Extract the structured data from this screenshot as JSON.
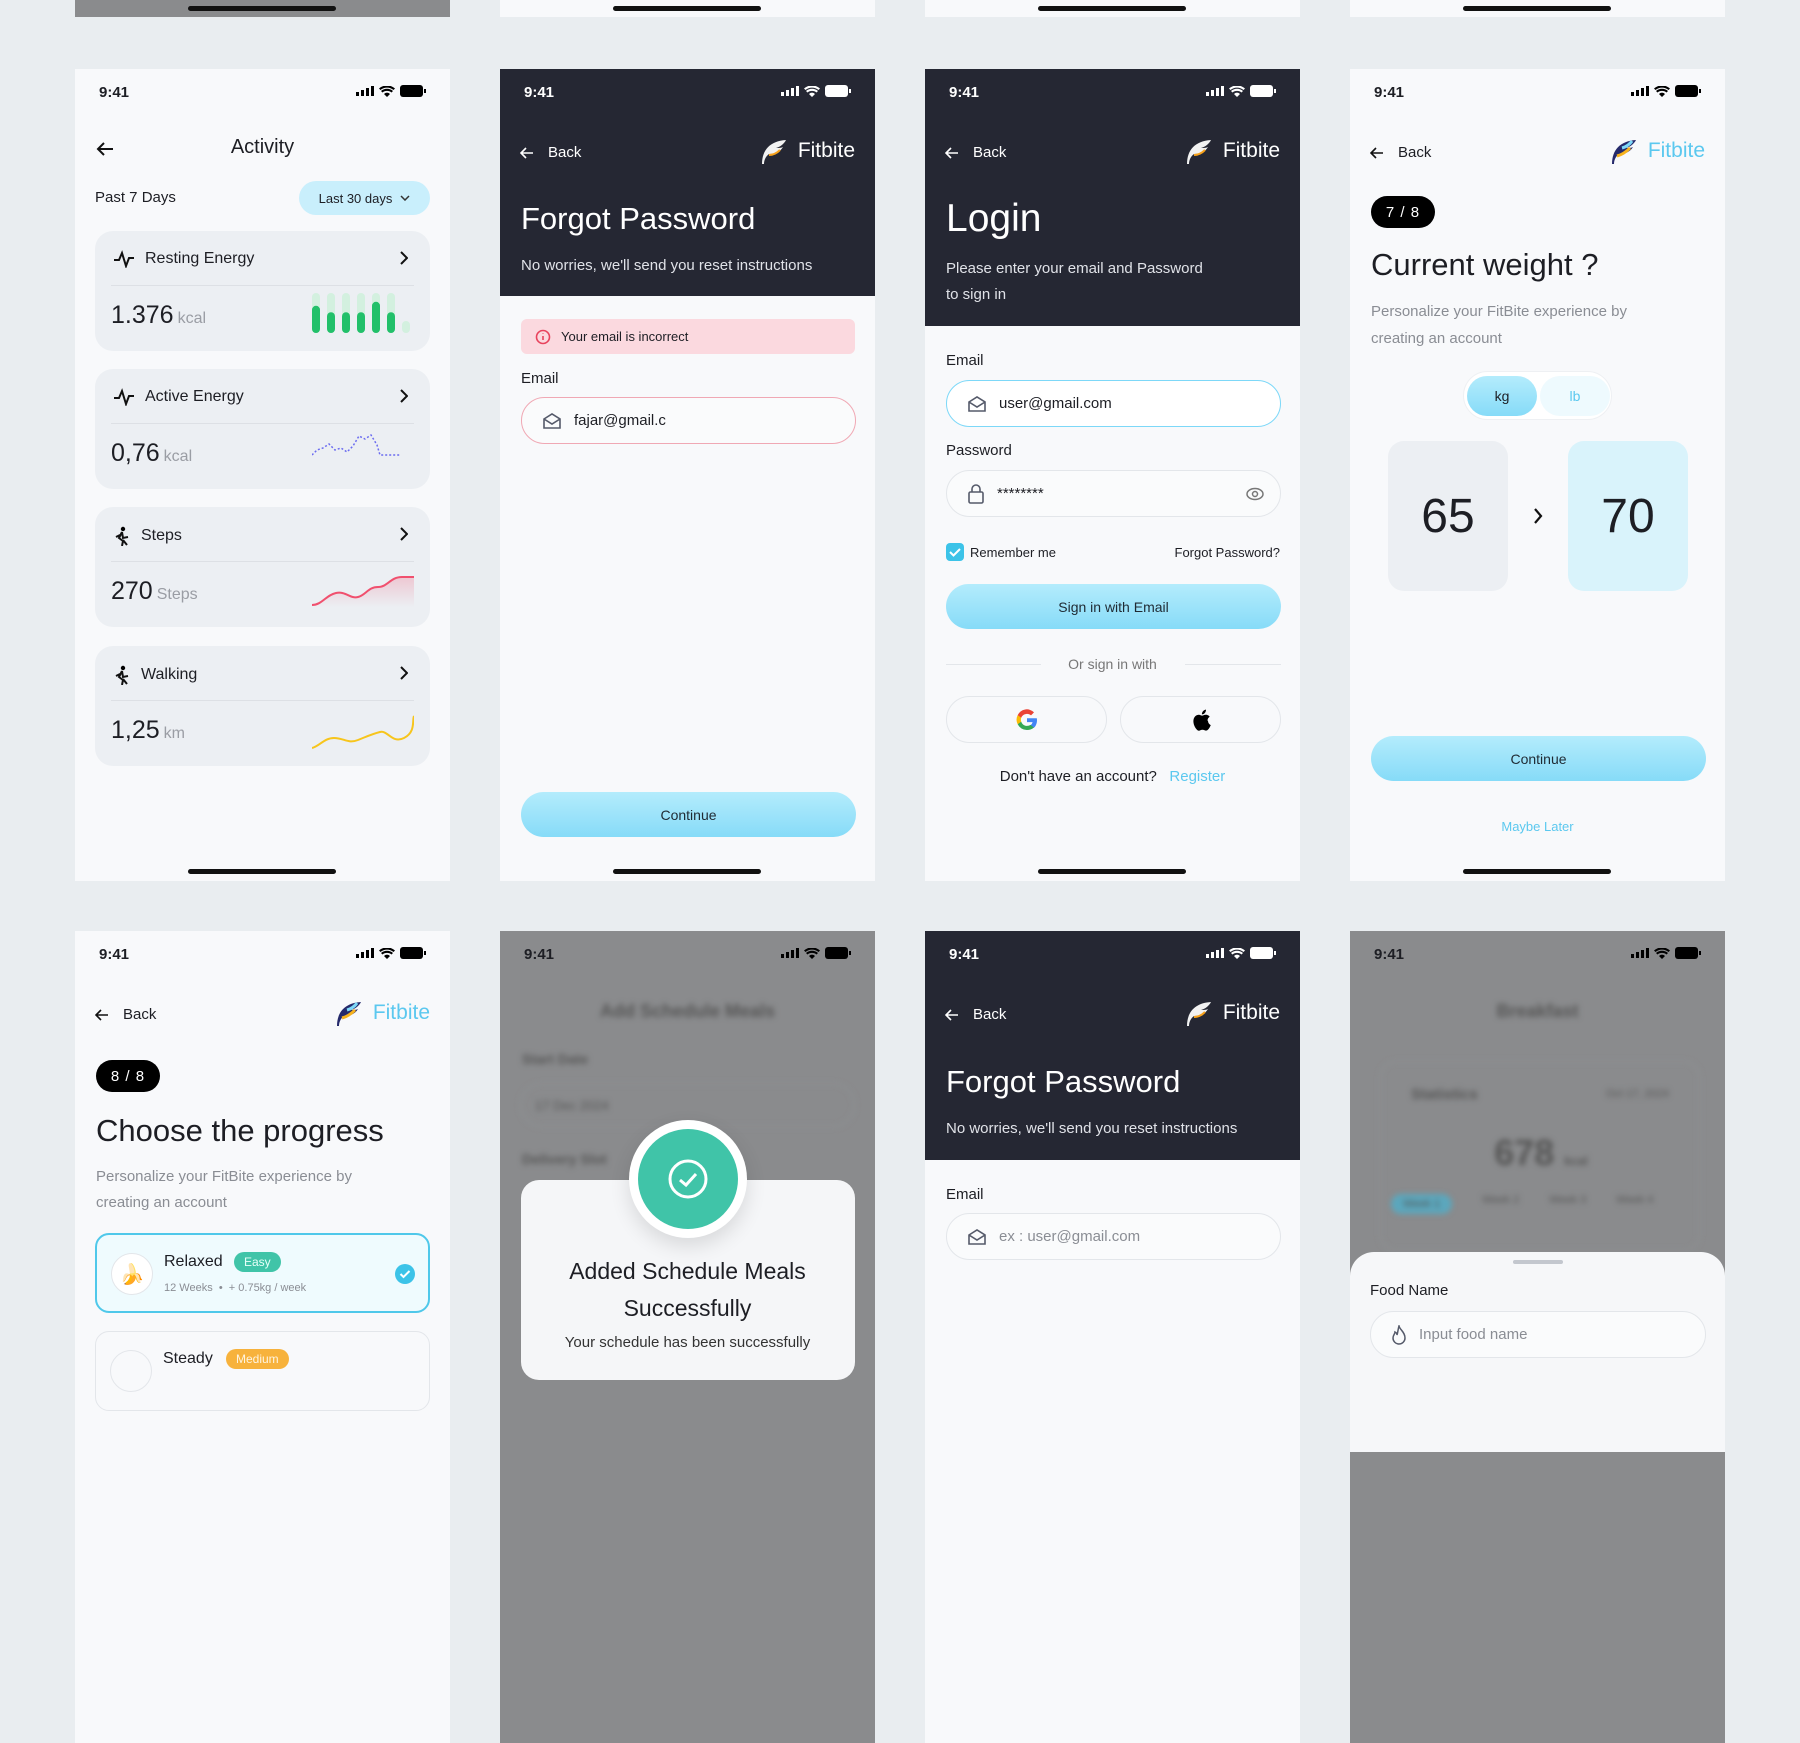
{
  "status": {
    "time": "9:41"
  },
  "brand": {
    "name": "Fitbite"
  },
  "common": {
    "back": "Back",
    "continue": "Continue",
    "email_label": "Email"
  },
  "activity": {
    "title": "Activity",
    "period_label": "Past 7 Days",
    "filter": "Last 30 days",
    "cards": [
      {
        "title": "Resting Energy",
        "value": "1.376",
        "unit": "kcal",
        "bars": [
          0.68,
          0.52,
          0.52,
          0.52,
          0.78,
          0.52,
          0.3
        ],
        "color": "#22c06a"
      },
      {
        "title": "Active Energy",
        "value": "0,76",
        "unit": "kcal",
        "color": "#6b6cf0"
      },
      {
        "title": "Steps",
        "value": "270",
        "unit": "Steps",
        "color": "#f0506e"
      },
      {
        "title": "Walking",
        "value": "1,25",
        "unit": "km",
        "color": "#f7c51c"
      }
    ]
  },
  "forgot1": {
    "title": "Forgot Password",
    "subtitle": "No worries, we'll send you reset instructions",
    "error": "Your email is incorrect",
    "email_value": "fajar@gmail.c"
  },
  "login": {
    "title": "Login",
    "subtitle_1": "Please enter your email and Password",
    "subtitle_2": "to sign in",
    "email_value": "user@gmail.com",
    "password_label": "Password",
    "password_value": "********",
    "remember": "Remember me",
    "remember_checked": true,
    "forgot": "Forgot Password?",
    "sign_in": "Sign in with Email",
    "or": "Or sign in with",
    "no_account": "Don't have an account?",
    "register": "Register"
  },
  "weight": {
    "step": "7 / 8",
    "title": "Current weight ?",
    "subtitle_1": "Personalize your FitBite experience by",
    "subtitle_2": "creating an account",
    "units": [
      "kg",
      "lb"
    ],
    "selected_unit": "kg",
    "current": "65",
    "target": "70",
    "maybe_later": "Maybe Later"
  },
  "progress": {
    "step": "8 / 8",
    "title": "Choose the progress",
    "subtitle_1": "Personalize your FitBite experience by",
    "subtitle_2": "creating an account",
    "options": [
      {
        "name": "Relaxed",
        "level": "Easy",
        "weeks": "12 Weeks",
        "rate": "+ 0.75kg / week",
        "selected": true
      },
      {
        "name": "Steady",
        "level": "Medium"
      }
    ]
  },
  "success": {
    "bg_title": "Add Schedule Meals",
    "bg_start": "Start Date",
    "bg_date": "17 Dec 2024",
    "bg_slot": "Delivery Slot",
    "title_1": "Added Schedule Meals",
    "title_2": "Successfully",
    "body": "Your schedule has been successfully"
  },
  "forgot2": {
    "title": "Forgot Password",
    "subtitle": "No worries, we'll send you reset instructions",
    "email_placeholder": "ex : user@gmail.com"
  },
  "breakfast": {
    "bg_title": "Breakfast",
    "bg_stats": "Statistics",
    "bg_date": "Oct 17, 2024",
    "bg_value": "678",
    "bg_unit": "kcal",
    "bg_weeks": [
      "Week 1",
      "Week 2",
      "Week 3",
      "Week 4"
    ],
    "food_label": "Food Name",
    "food_placeholder": "Input food name"
  },
  "colors": {
    "accent": "#5bc8ef",
    "dark": "#252733",
    "success": "#40c4a8",
    "error": "#e8435d"
  }
}
